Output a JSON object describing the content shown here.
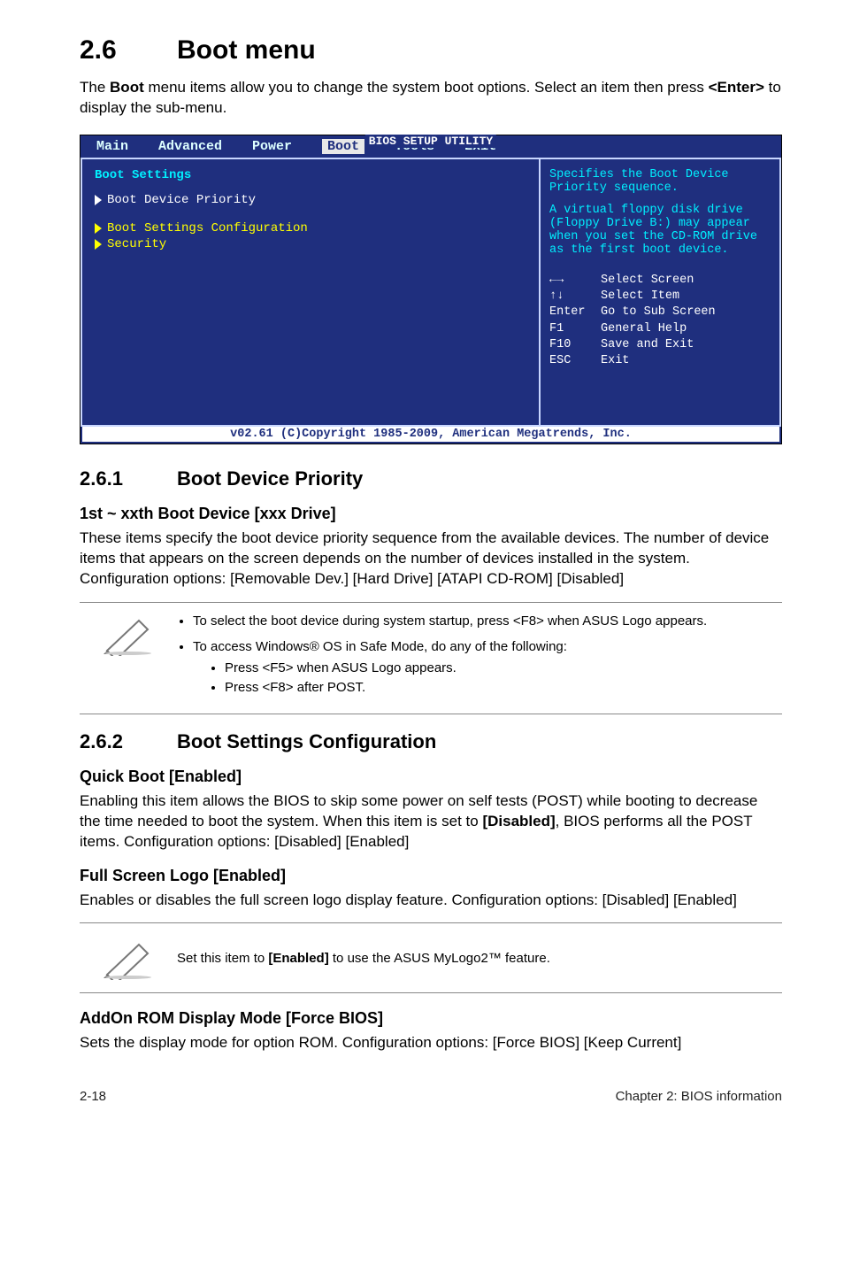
{
  "section": {
    "number": "2.6",
    "title": "Boot menu"
  },
  "intro": {
    "pre": "The ",
    "bold1": "Boot",
    "mid": " menu items allow you to change the system boot options. Select an item then press ",
    "bold2": "<Enter>",
    "post": " to display the sub-menu."
  },
  "bios": {
    "title_label": "BIOS SETUP UTILITY",
    "menu": [
      "Main",
      "Advanced",
      "Power",
      "Boot",
      "Tools",
      "Exit"
    ],
    "selected_tab": "Boot",
    "left": {
      "heading": "Boot Settings",
      "item1": "Boot Device Priority",
      "item2": "Boot Settings Configuration",
      "item3": "Security"
    },
    "right": {
      "line1": "Specifies the Boot Device Priority sequence.",
      "line2": "A virtual floppy disk drive (Floppy Drive B:) may appear when you set the CD-ROM drive as the first boot device.",
      "k1": "←→",
      "v1": "Select Screen",
      "k2": "↑↓",
      "v2": "Select Item",
      "k3": "Enter",
      "v3": "Go to Sub Screen",
      "k4": "F1",
      "v4": "General Help",
      "k5": "F10",
      "v5": "Save and Exit",
      "k6": "ESC",
      "v6": "Exit"
    },
    "footer": "v02.61 (C)Copyright 1985-2009, American Megatrends, Inc."
  },
  "s261": {
    "num": "2.6.1",
    "title": "Boot Device Priority",
    "opt_heading": "1st ~ xxth Boot Device [xxx Drive]",
    "para": "These items specify the boot device priority sequence from the available devices. The number of device items that appears on the screen depends on the number of devices installed in the system. Configuration options: [Removable Dev.] [Hard Drive] [ATAPI CD-ROM] [Disabled]"
  },
  "note1": {
    "li1": "To select the boot device during system startup, press <F8> when ASUS Logo appears.",
    "li2": "To access Windows® OS in Safe Mode, do any of the following:",
    "sub1": "Press <F5> when ASUS Logo appears.",
    "sub2": "Press <F8> after POST."
  },
  "s262": {
    "num": "2.6.2",
    "title": "Boot Settings Configuration",
    "quick_h": "Quick Boot [Enabled]",
    "quick_p_pre": "Enabling this item allows the BIOS to skip some power on self tests (POST) while booting to decrease the time needed to boot the system. When this item is set to ",
    "quick_p_bold": "[Disabled]",
    "quick_p_post": ", BIOS performs all the POST items. Configuration options: [Disabled] [Enabled]",
    "full_h": "Full Screen Logo [Enabled]",
    "full_p": "Enables or disables the full screen logo display feature. Configuration options: [Disabled] [Enabled]"
  },
  "note2": {
    "pre": "Set this item to ",
    "bold": "[Enabled]",
    "post": " to use the ASUS MyLogo2™ feature."
  },
  "addon": {
    "h": "AddOn ROM Display Mode [Force BIOS]",
    "p": "Sets the display mode for option ROM. Configuration options: [Force BIOS] [Keep Current]"
  },
  "footer": {
    "left": "2-18",
    "right": "Chapter 2: BIOS information"
  }
}
